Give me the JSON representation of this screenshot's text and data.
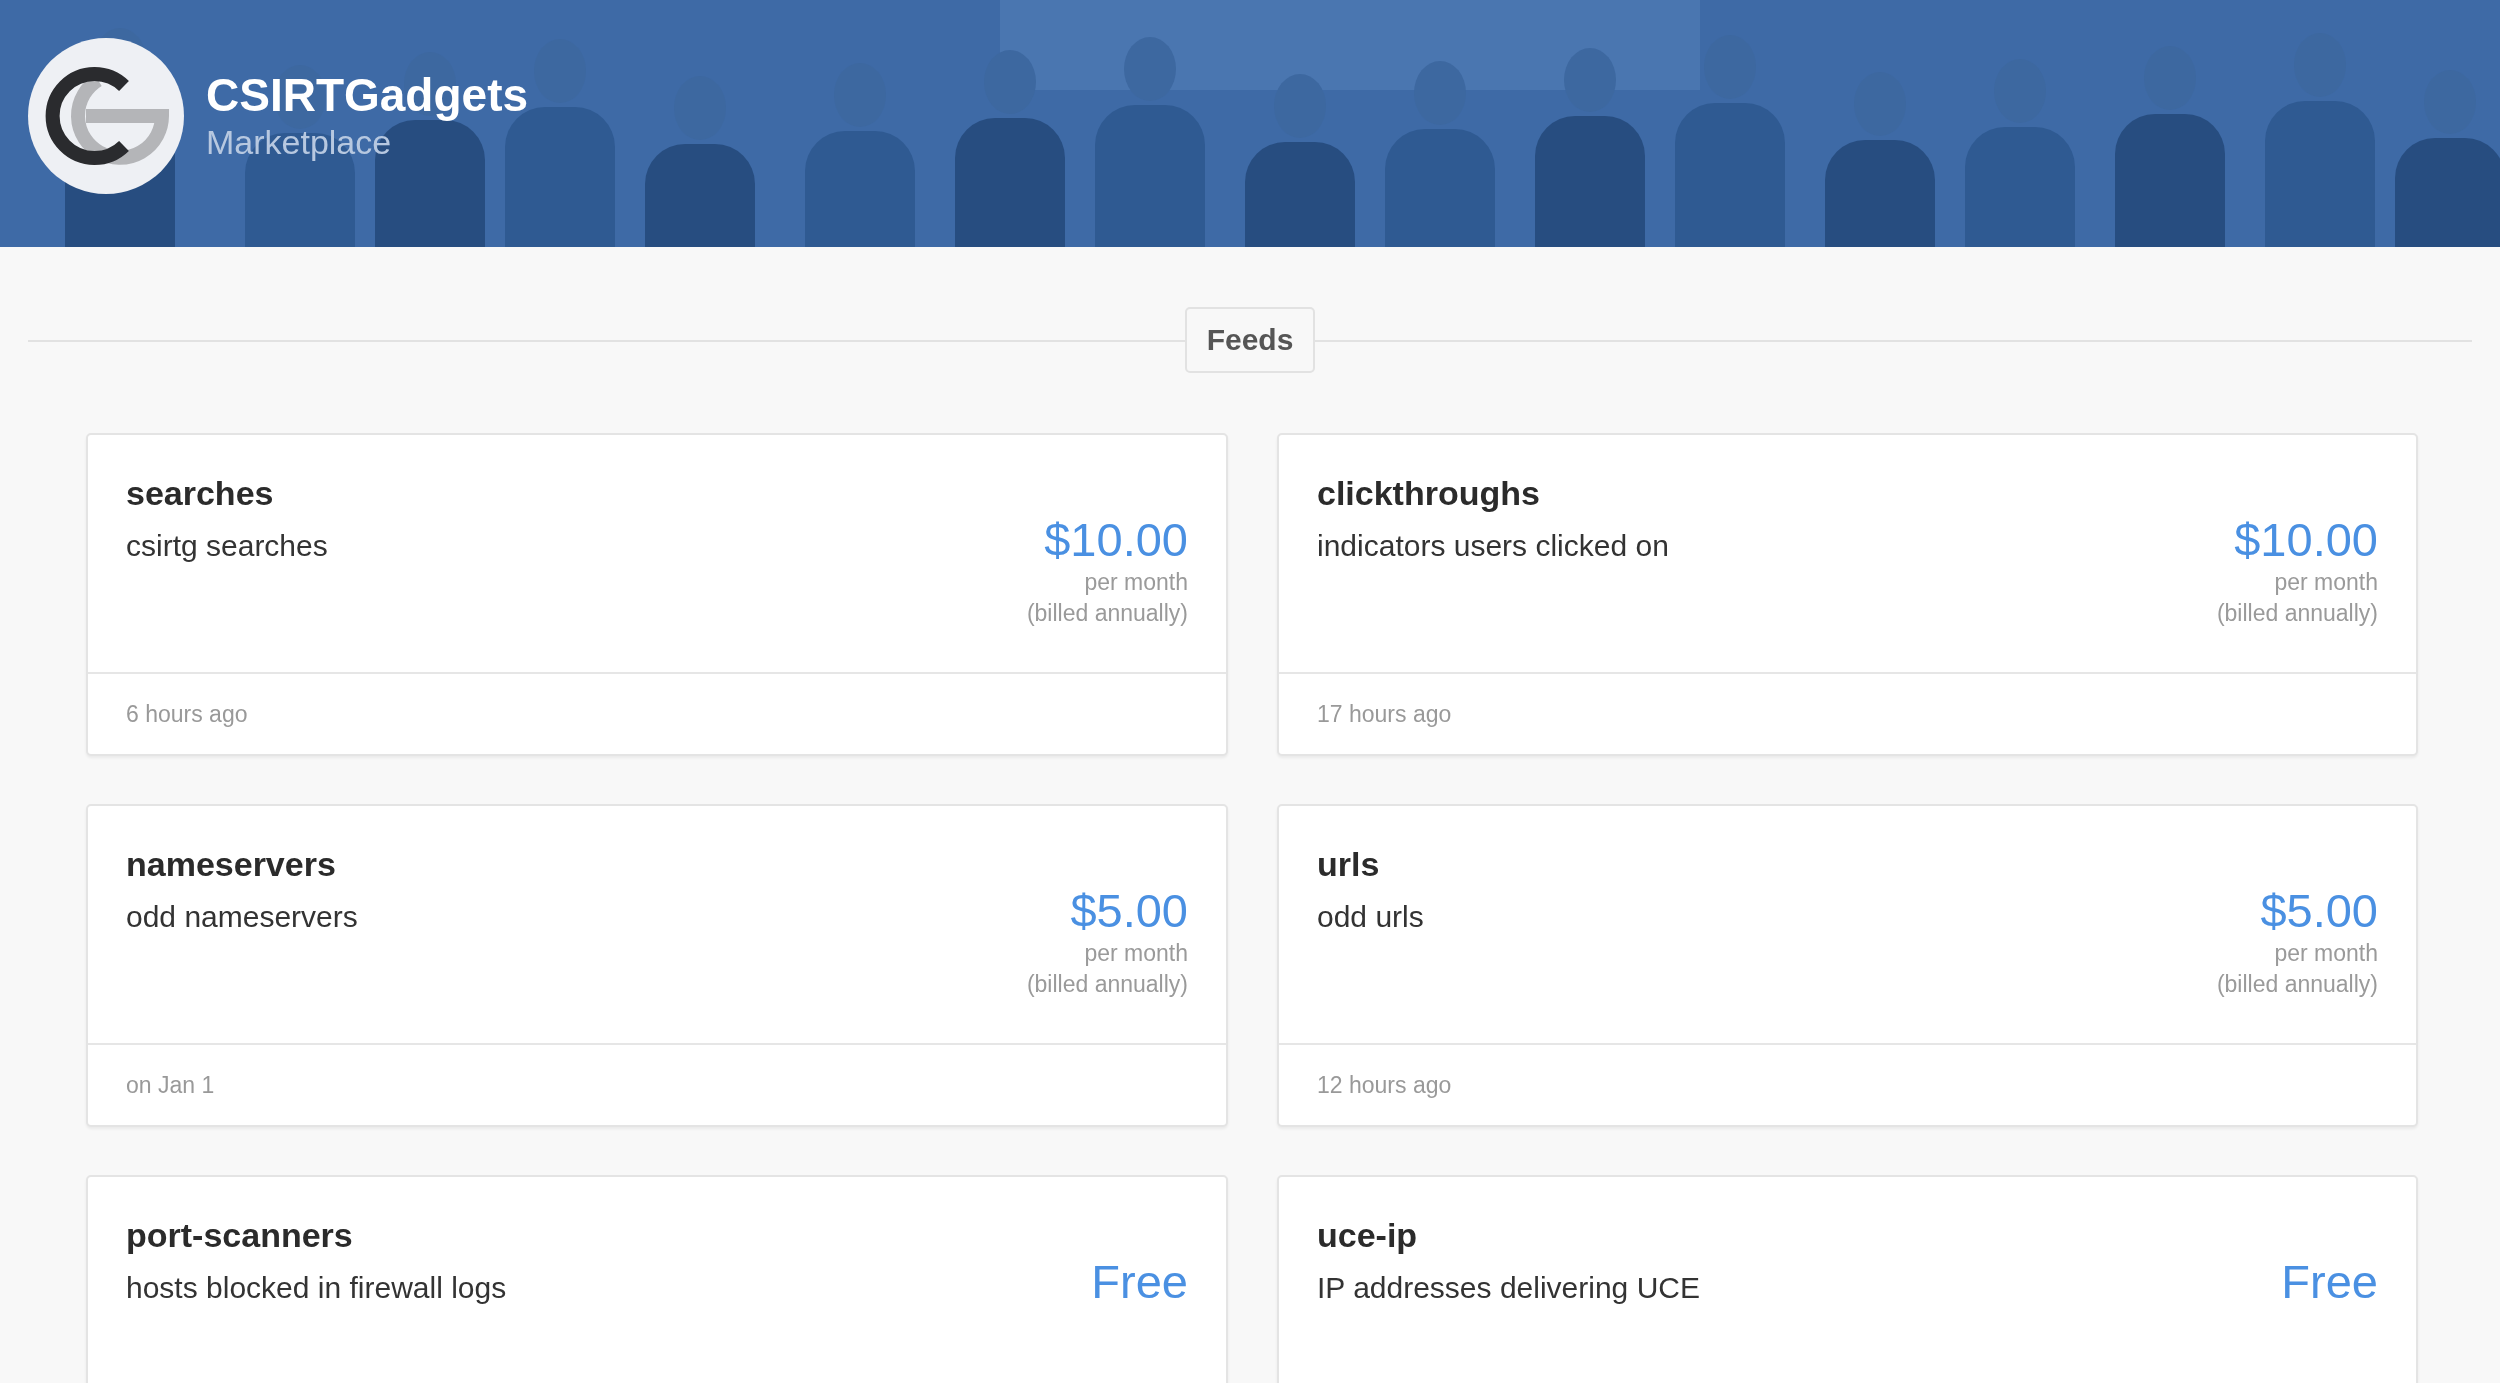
{
  "header": {
    "title": "CSIRTGadgets",
    "subtitle": "Marketplace"
  },
  "section": {
    "label": "Feeds"
  },
  "feeds": [
    {
      "name": "searches",
      "description": "csirtg searches",
      "price": "$10.00",
      "period": "per month",
      "billing": "(billed annually)",
      "updated": "6 hours ago"
    },
    {
      "name": "clickthroughs",
      "description": "indicators users clicked on",
      "price": "$10.00",
      "period": "per month",
      "billing": "(billed annually)",
      "updated": "17 hours ago"
    },
    {
      "name": "nameservers",
      "description": "odd nameservers",
      "price": "$5.00",
      "period": "per month",
      "billing": "(billed annually)",
      "updated": "on Jan 1"
    },
    {
      "name": "urls",
      "description": "odd urls",
      "price": "$5.00",
      "period": "per month",
      "billing": "(billed annually)",
      "updated": "12 hours ago"
    },
    {
      "name": "port-scanners",
      "description": "hosts blocked in firewall logs",
      "price": "Free"
    },
    {
      "name": "uce-ip",
      "description": "IP addresses delivering UCE",
      "price": "Free"
    }
  ]
}
